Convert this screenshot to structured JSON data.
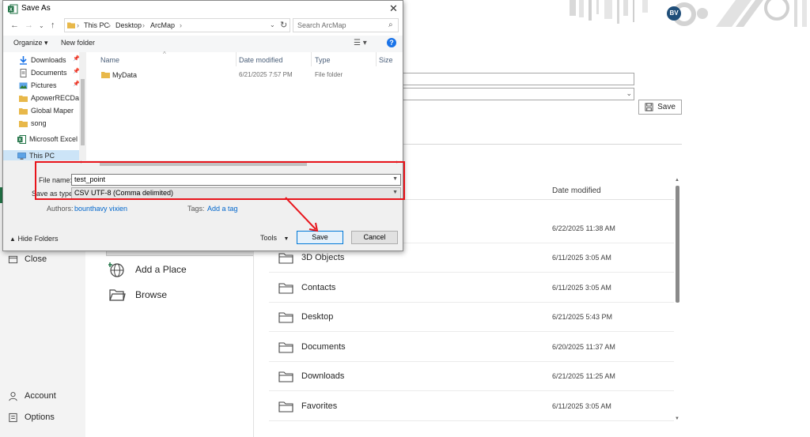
{
  "backstage": {
    "avatar_initials": "BV",
    "nav": {
      "close": "Close",
      "account": "Account",
      "options": "Options"
    },
    "places": {
      "add_place": "Add a Place",
      "browse": "Browse"
    },
    "save_button": "Save",
    "list_header_date": "Date modified",
    "rows": [
      {
        "name": "",
        "date": "6/22/2025 11:38 AM"
      },
      {
        "name": "3D Objects",
        "date": "6/11/2025 3:05 AM"
      },
      {
        "name": "Contacts",
        "date": "6/11/2025 3:05 AM"
      },
      {
        "name": "Desktop",
        "date": "6/21/2025 5:43 PM"
      },
      {
        "name": "Documents",
        "date": "6/20/2025 11:37 AM"
      },
      {
        "name": "Downloads",
        "date": "6/21/2025 11:25 AM"
      },
      {
        "name": "Favorites",
        "date": "6/11/2025 3:05 AM"
      }
    ],
    "accent_color": "#217346"
  },
  "dialog": {
    "title": "Save As",
    "breadcrumb": [
      "This PC",
      "Desktop",
      "ArcMap"
    ],
    "search_placeholder": "Search ArcMap",
    "toolbar": {
      "organize": "Organize ▾",
      "new_folder": "New folder"
    },
    "tree": [
      {
        "label": "Downloads",
        "icon": "download-icon",
        "pinned": true
      },
      {
        "label": "Documents",
        "icon": "document-icon",
        "pinned": true
      },
      {
        "label": "Pictures",
        "icon": "pictures-icon",
        "pinned": true
      },
      {
        "label": "ApowerRECData",
        "icon": "folder-icon",
        "pinned": false
      },
      {
        "label": "Global Maper",
        "icon": "folder-icon",
        "pinned": false
      },
      {
        "label": "song",
        "icon": "folder-icon",
        "pinned": false
      },
      {
        "label": "Microsoft Excel",
        "icon": "excel-icon",
        "pinned": false
      },
      {
        "label": "This PC",
        "icon": "computer-icon",
        "pinned": false
      }
    ],
    "columns": {
      "name": "Name",
      "date": "Date modified",
      "type": "Type",
      "size": "Size"
    },
    "files": [
      {
        "name": "MyData",
        "date": "6/21/2025 7:57 PM",
        "type": "File folder"
      }
    ],
    "form": {
      "file_name_label": "File name:",
      "file_name_value": "test_point",
      "save_as_type_label": "Save as type:",
      "save_as_type_value": "CSV UTF-8 (Comma delimited)",
      "authors_label": "Authors:",
      "authors_value": "bounthavy vixien",
      "tags_label": "Tags:",
      "tags_value": "Add a tag"
    },
    "footer": {
      "hide_folders": "Hide Folders",
      "tools": "Tools",
      "save": "Save",
      "cancel": "Cancel"
    },
    "highlight_color": "#e8141b"
  }
}
